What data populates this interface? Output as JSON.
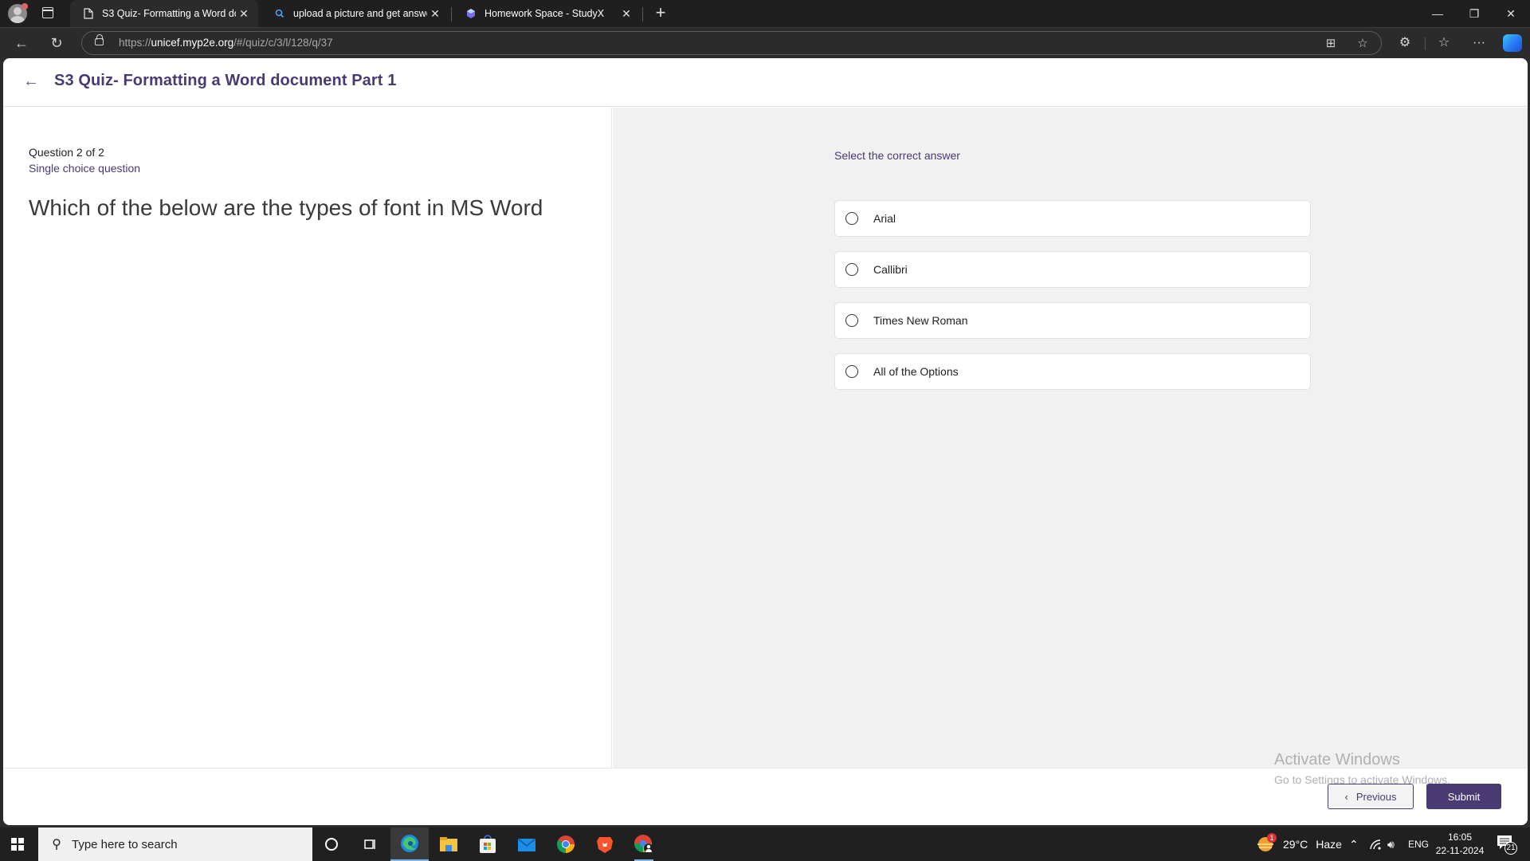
{
  "browser": {
    "tabs": [
      {
        "label": "S3 Quiz- Formatting a Word docu",
        "icon": "document-icon",
        "active": true
      },
      {
        "label": "upload a picture and get answers",
        "icon": "search-icon",
        "active": false
      },
      {
        "label": "Homework Space - StudyX",
        "icon": "studyx-gem-icon",
        "active": false
      }
    ],
    "new_tab_label": "+",
    "window_controls": {
      "minimize": "—",
      "restore": "❐",
      "close": "✕"
    },
    "url_prefix": "https://",
    "url_domain": "unicef.myp2e.org",
    "url_path": "/#/quiz/c/3/l/128/q/37"
  },
  "page": {
    "title": "S3 Quiz- Formatting a Word document Part 1",
    "question": {
      "counter": "Question 2 of 2",
      "type": "Single choice question",
      "text": "Which of the below are the types of font in MS Word"
    },
    "answers": {
      "instruction": "Select the correct answer",
      "options": [
        {
          "label": "Arial",
          "selected": false
        },
        {
          "label": "Callibri",
          "selected": false
        },
        {
          "label": "Times New Roman",
          "selected": false
        },
        {
          "label": "All of the Options",
          "selected": false
        }
      ]
    },
    "footer": {
      "previous_label": "Previous",
      "submit_label": "Submit"
    },
    "colors": {
      "brand": "#4a3a73",
      "pane_bg": "#f1f1f1"
    }
  },
  "watermark": {
    "line1": "Activate Windows",
    "line2": "Go to Settings to activate Windows."
  },
  "taskbar": {
    "search_placeholder": "Type here to search",
    "weather_temp": "29°C",
    "weather_desc": "Haze",
    "weather_badge": "1",
    "language": "ENG",
    "time": "16:05",
    "date": "22-11-2024",
    "notification_count": "21"
  }
}
